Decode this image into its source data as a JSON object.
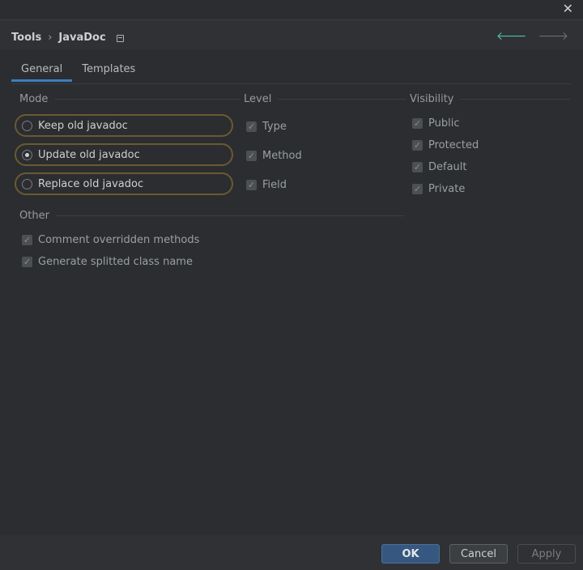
{
  "window": {
    "close_glyph": "✕"
  },
  "breadcrumb": {
    "parent": "Tools",
    "separator": "›",
    "current": "JavaDoc"
  },
  "nav": {
    "back_glyph": "🡐",
    "forward_glyph": "🡒"
  },
  "tabs": [
    {
      "label": "General",
      "active": true
    },
    {
      "label": "Templates",
      "active": false
    }
  ],
  "mode": {
    "title": "Mode",
    "options": [
      {
        "label": "Keep old javadoc",
        "selected": false
      },
      {
        "label": "Update old javadoc",
        "selected": true
      },
      {
        "label": "Replace old javadoc",
        "selected": false
      }
    ]
  },
  "level": {
    "title": "Level",
    "items": [
      {
        "label": "Type",
        "checked": true
      },
      {
        "label": "Method",
        "checked": true
      },
      {
        "label": "Field",
        "checked": true
      }
    ]
  },
  "visibility": {
    "title": "Visibility",
    "items": [
      {
        "label": "Public",
        "checked": true
      },
      {
        "label": "Protected",
        "checked": true
      },
      {
        "label": "Default",
        "checked": true
      },
      {
        "label": "Private",
        "checked": true
      }
    ]
  },
  "other": {
    "title": "Other",
    "items": [
      {
        "label": "Comment overridden methods",
        "checked": true
      },
      {
        "label": "Generate splitted class name",
        "checked": true
      }
    ]
  },
  "footer": {
    "ok_label": "OK",
    "cancel_label": "Cancel",
    "apply_label": "Apply"
  },
  "colors": {
    "accent": "#3d7ebf",
    "primary_button": "#365880",
    "focus_ring": "#6a5a32",
    "nav_back": "#4ec2a8"
  }
}
